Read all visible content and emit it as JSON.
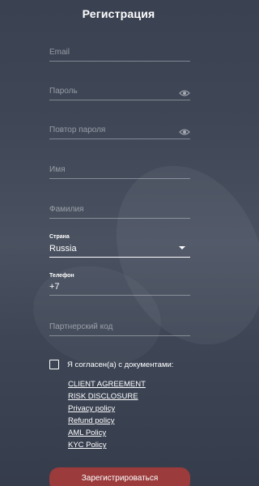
{
  "page": {
    "title": "Регистрация"
  },
  "form": {
    "email_placeholder": "Email",
    "password_placeholder": "Пароль",
    "password_repeat_placeholder": "Повтор пароля",
    "first_name_placeholder": "Имя",
    "last_name_placeholder": "Фамилия",
    "country": {
      "label": "Страна",
      "value": "Russia"
    },
    "phone": {
      "label": "Телефон",
      "value": "+7"
    },
    "partner_code_placeholder": "Партнерский код",
    "agreement": {
      "text": "Я согласен(а) с документами:",
      "checked": false
    },
    "documents": [
      "CLIENT AGREEMENT",
      "RISK DISCLOSURE",
      "Privacy policy",
      "Refund policy",
      "AML Policy",
      "KYC Policy"
    ],
    "submit_label": "Зарегистрироваться"
  },
  "icons": {
    "password_visibility": "eye-icon",
    "country_dropdown": "caret-down-icon"
  },
  "colors": {
    "background": "#3f4757",
    "submit_button": "#9b3b3c",
    "text": "#ffffff"
  }
}
